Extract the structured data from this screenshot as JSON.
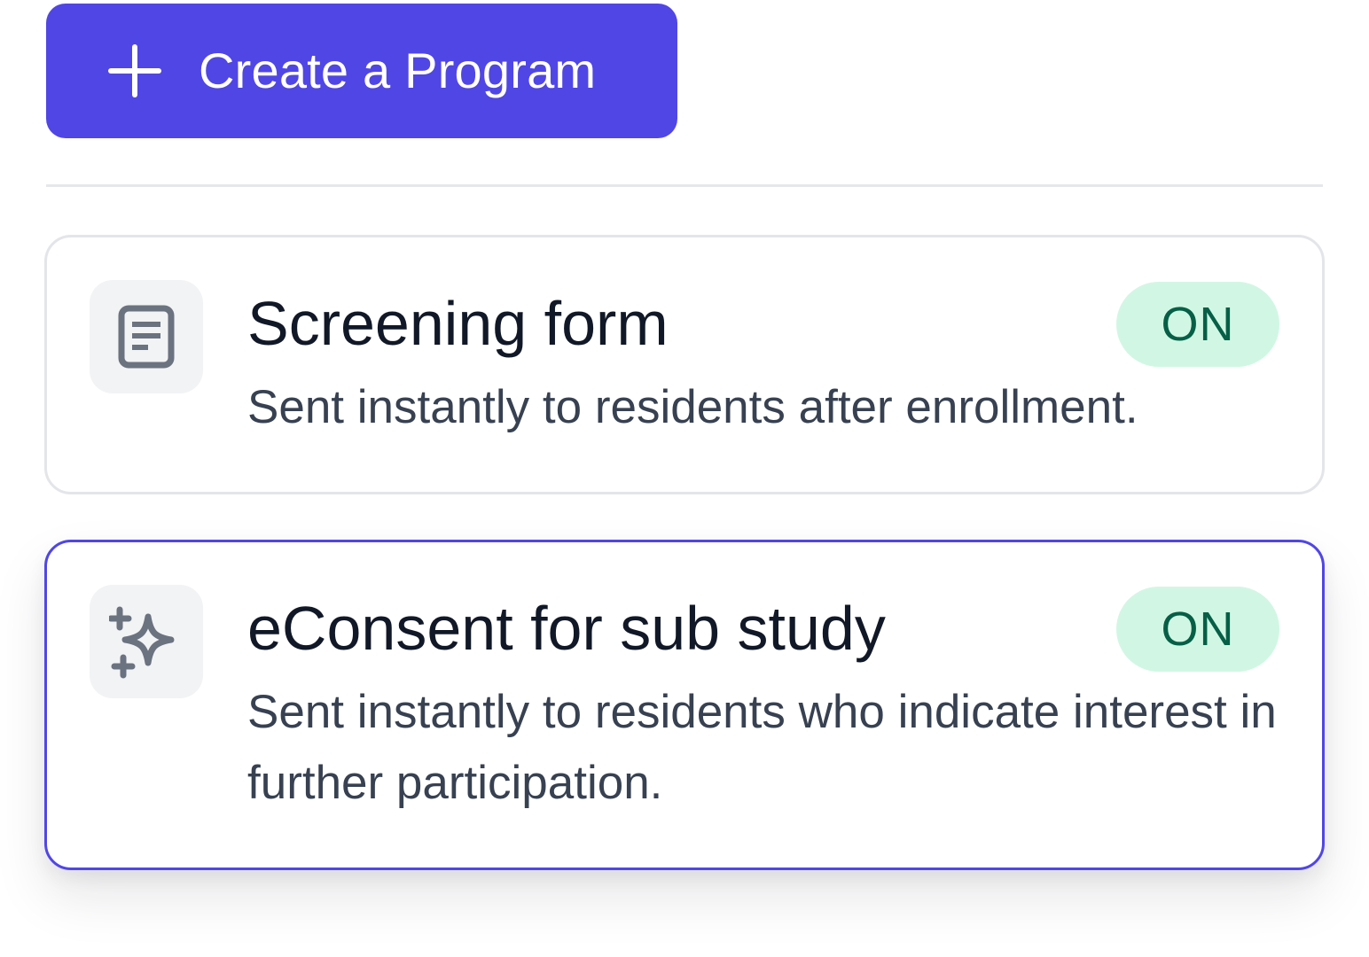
{
  "create_button": {
    "label": "Create a Program",
    "icon": "plus-icon",
    "color": "#5046e5"
  },
  "programs": [
    {
      "title": "Screening form",
      "description": "Sent instantly to residents after enrollment.",
      "status": "ON",
      "icon": "document-icon",
      "selected": false
    },
    {
      "title": "eConsent for sub study",
      "description": "Sent instantly to residents who indicate interest in further participation.",
      "status": "ON",
      "icon": "sparkles-icon",
      "selected": true
    }
  ],
  "colors": {
    "accent": "#5046e5",
    "badge_bg": "#d1f7e4",
    "badge_text": "#065f46",
    "title_text": "#111827",
    "body_text": "#374151",
    "icon_gray": "#6b7280"
  }
}
